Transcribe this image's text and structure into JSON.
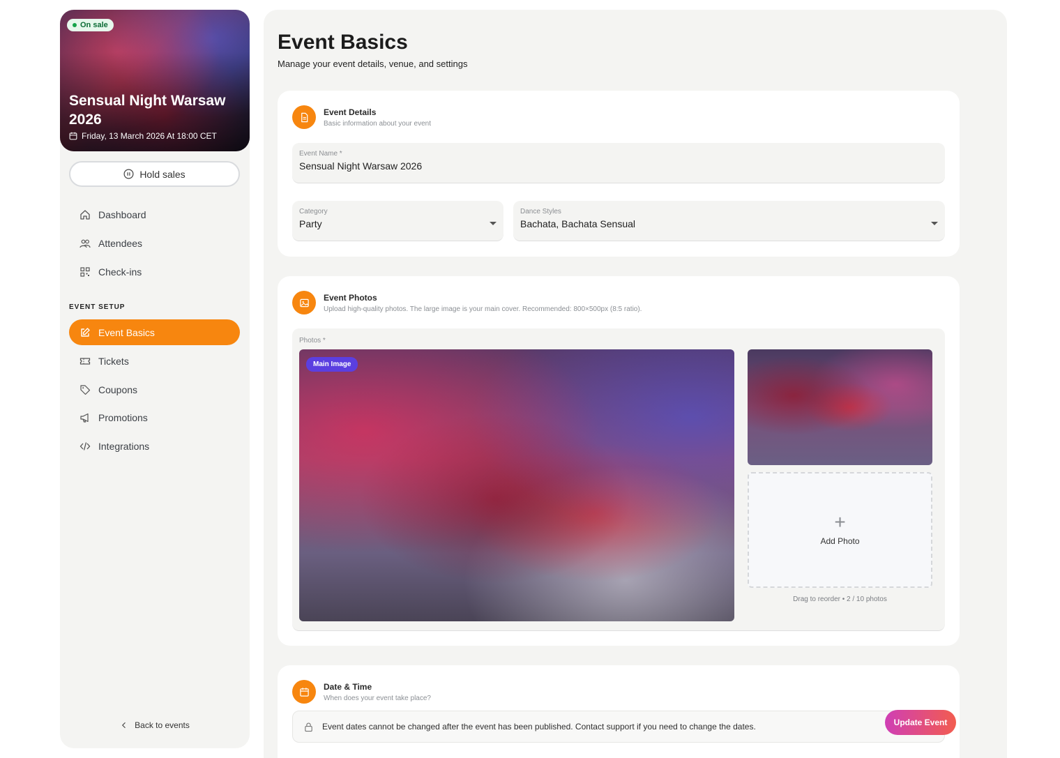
{
  "sidebar": {
    "hero": {
      "badge": "On sale",
      "title": "Sensual Night Warsaw 2026",
      "date": "Friday, 13 March 2026 At 18:00 CET"
    },
    "hold_label": "Hold sales",
    "nav_top": [
      {
        "label": "Dashboard",
        "icon": "home-icon"
      },
      {
        "label": "Attendees",
        "icon": "users-icon"
      },
      {
        "label": "Check-ins",
        "icon": "qr-code-icon"
      }
    ],
    "section_label": "EVENT SETUP",
    "nav_setup": [
      {
        "label": "Event Basics",
        "icon": "edit-icon",
        "active": true
      },
      {
        "label": "Tickets",
        "icon": "ticket-icon"
      },
      {
        "label": "Coupons",
        "icon": "tag-icon"
      },
      {
        "label": "Promotions",
        "icon": "megaphone-icon"
      },
      {
        "label": "Integrations",
        "icon": "code-icon"
      }
    ],
    "back_label": "Back to events"
  },
  "main": {
    "title": "Event Basics",
    "subtitle": "Manage your event details, venue, and settings",
    "details": {
      "title": "Event Details",
      "desc": "Basic information about your event",
      "name_label": "Event Name *",
      "name_value": "Sensual Night Warsaw 2026",
      "category_label": "Category",
      "category_value": "Party",
      "styles_label": "Dance Styles",
      "styles_value": "Bachata, Bachata Sensual"
    },
    "photos": {
      "title": "Event Photos",
      "desc": "Upload high-quality photos. The large image is your main cover. Recommended: 800×500px (8:5 ratio).",
      "label": "Photos *",
      "main_badge": "Main Image",
      "add_label": "Add Photo",
      "reorder_text": "Drag to reorder • 2 / 10 photos"
    },
    "datetime": {
      "title": "Date & Time",
      "desc": "When does your event take place?",
      "notice": "Event dates cannot be changed after the event has been published. Contact support if you need to change the dates."
    },
    "update_label": "Update Event"
  },
  "colors": {
    "accent": "#f7860f",
    "badge_purple": "#5b3fe0",
    "on_sale_green": "#16a34a"
  }
}
